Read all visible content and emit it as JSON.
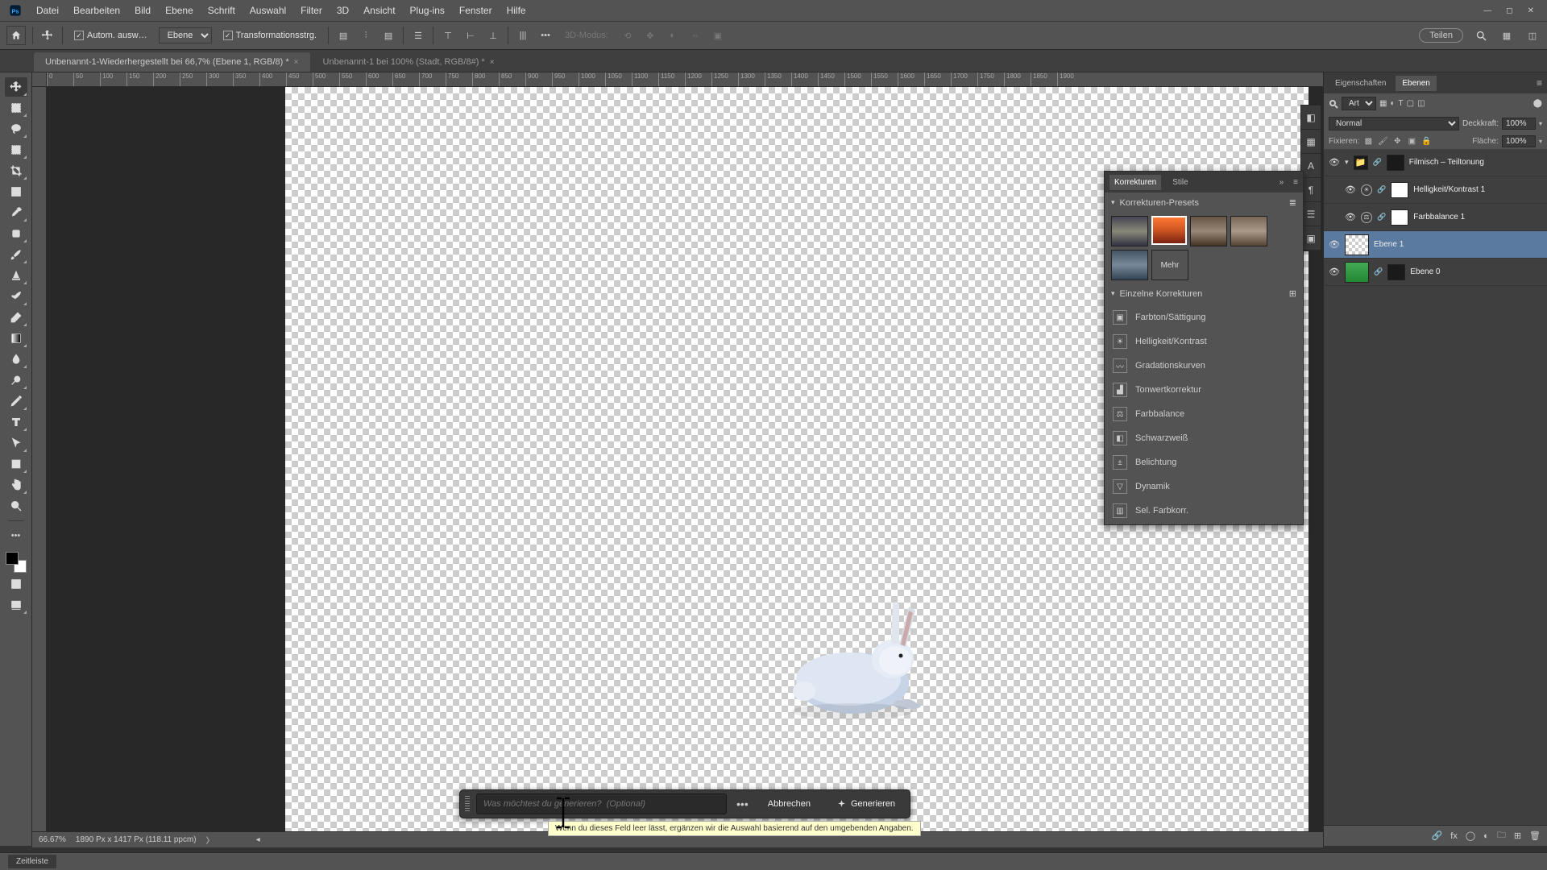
{
  "menubar": {
    "items": [
      "Datei",
      "Bearbeiten",
      "Bild",
      "Ebene",
      "Schrift",
      "Auswahl",
      "Filter",
      "3D",
      "Ansicht",
      "Plug-ins",
      "Fenster",
      "Hilfe"
    ]
  },
  "optionbar": {
    "auto_select": "Autom. ausw…",
    "layer_select": "Ebene",
    "transform_controls": "Transformationsstrg.",
    "mode_3d": "3D-Modus:",
    "share": "Teilen"
  },
  "tabs": [
    {
      "label": "Unbenannt-1-Wiederhergestellt bei 66,7% (Ebene 1, RGB/8) *",
      "active": true
    },
    {
      "label": "Unbenannt-1 bei 100% (Stadt, RGB/8#) *",
      "active": false
    }
  ],
  "ruler_ticks": [
    "0",
    "50",
    "100",
    "150",
    "200",
    "250",
    "300",
    "350",
    "400",
    "450",
    "500",
    "550",
    "600",
    "650",
    "700",
    "750",
    "800",
    "850",
    "900",
    "950",
    "1000",
    "1050",
    "1100",
    "1150",
    "1200",
    "1250",
    "1300",
    "1350",
    "1400",
    "1450",
    "1500",
    "1550",
    "1600",
    "1650",
    "1700",
    "1750",
    "1800",
    "1850",
    "1900"
  ],
  "float_panel": {
    "tabs": [
      "Korrekturen",
      "Stile"
    ],
    "presets_title": "Korrekturen-Presets",
    "more": "Mehr",
    "single_title": "Einzelne Korrekturen",
    "items": [
      "Farbton/Sättigung",
      "Helligkeit/Kontrast",
      "Gradationskurven",
      "Tonwertkorrektur",
      "Farbbalance",
      "Schwarzweiß",
      "Belichtung",
      "Dynamik",
      "Sel. Farbkorr."
    ]
  },
  "layers_panel": {
    "tabs": [
      "Eigenschaften",
      "Ebenen"
    ],
    "filter_label": "Art",
    "blend_mode": "Normal",
    "opacity_label": "Deckkraft:",
    "opacity": "100%",
    "lock_label": "Fixieren:",
    "fill_label": "Fläche:",
    "fill": "100%",
    "layers": [
      {
        "name": "Filmisch – Teiltonung",
        "type": "group"
      },
      {
        "name": "Helligkeit/Kontrast 1",
        "type": "adj"
      },
      {
        "name": "Farbbalance 1",
        "type": "adj"
      },
      {
        "name": "Ebene 1",
        "type": "pixel",
        "selected": true
      },
      {
        "name": "Ebene 0",
        "type": "image"
      }
    ]
  },
  "gen_bar": {
    "placeholder": "Was möchtest du generieren?  (Optional)",
    "cancel": "Abbrechen",
    "generate": "Generieren",
    "tooltip": "Wenn du dieses Feld leer lässt, ergänzen wir die Auswahl basierend auf den umgebenden Angaben."
  },
  "statusbar": {
    "zoom": "66.67%",
    "info": "1890 Px x 1417 Px (118.11 ppcm)"
  },
  "timeline": {
    "label": "Zeitleiste"
  }
}
